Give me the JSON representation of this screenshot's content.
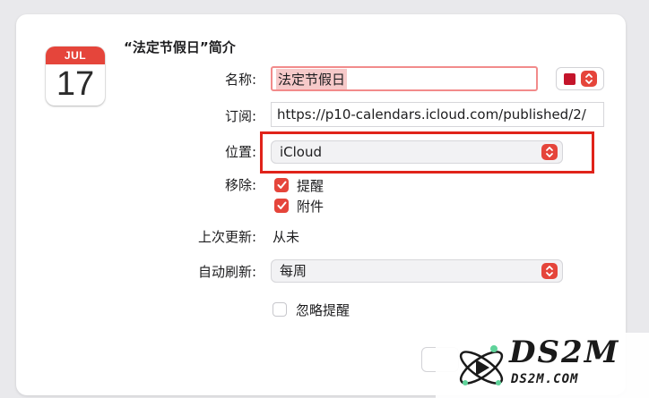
{
  "calendar_icon": {
    "month": "JUL",
    "day": "17"
  },
  "title": "“法定节假日”简介",
  "fields": {
    "name_label": "名称:",
    "name_value": "法定节假日",
    "subscribe_label": "订阅:",
    "subscribe_url": "https://p10-calendars.icloud.com/published/2/",
    "location_label": "位置:",
    "location_value": "iCloud",
    "remove_label": "移除:",
    "remove_alerts": "提醒",
    "remove_attachments": "附件",
    "last_updated_label": "上次更新:",
    "last_updated_value": "从未",
    "auto_refresh_label": "自动刷新:",
    "auto_refresh_value": "每周",
    "ignore_alerts": "忽略提醒"
  },
  "checkboxes": {
    "remove_alerts": true,
    "remove_attachments": true,
    "ignore_alerts": false
  },
  "colors": {
    "calendar_color": "#c4152b",
    "accent": "#e5453b",
    "highlight": "#e0231a"
  },
  "watermark": {
    "brand": "DS2M",
    "domain": "DS2M.COM"
  }
}
